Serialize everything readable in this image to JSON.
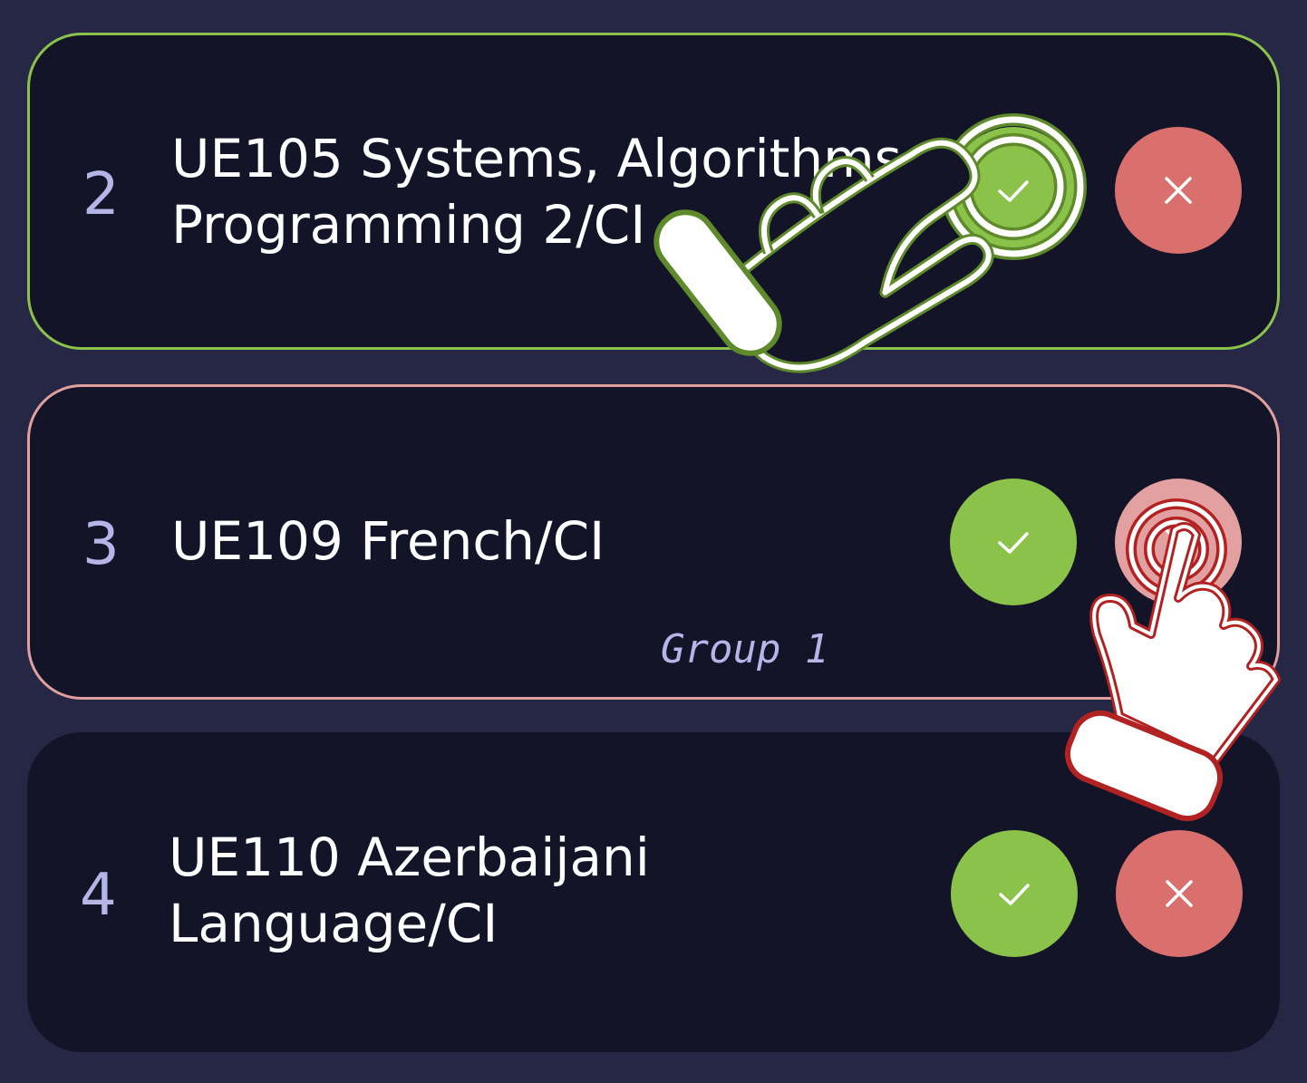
{
  "courses": [
    {
      "number": "2",
      "title_line1": "UE105 Systems, Algorithms,",
      "title_line2": "Programming 2/CI",
      "status": "accepted",
      "status_color": "#8bc34a"
    },
    {
      "number": "3",
      "title_line1": "UE109 French/CI",
      "group": "Group 1",
      "status": "rejected",
      "status_color": "#e0a0a0"
    },
    {
      "number": "4",
      "title_line1": "UE110 Azerbaijani",
      "title_line2": "Language/CI",
      "status": "pending"
    }
  ],
  "colors": {
    "background": "#262645",
    "card": "#141428",
    "accept": "#8bc34a",
    "reject": "#d9706e",
    "number": "#b5b5e8"
  },
  "icons": {
    "accept": "check-icon",
    "reject": "close-icon",
    "gesture": "tap-hand-icon"
  }
}
